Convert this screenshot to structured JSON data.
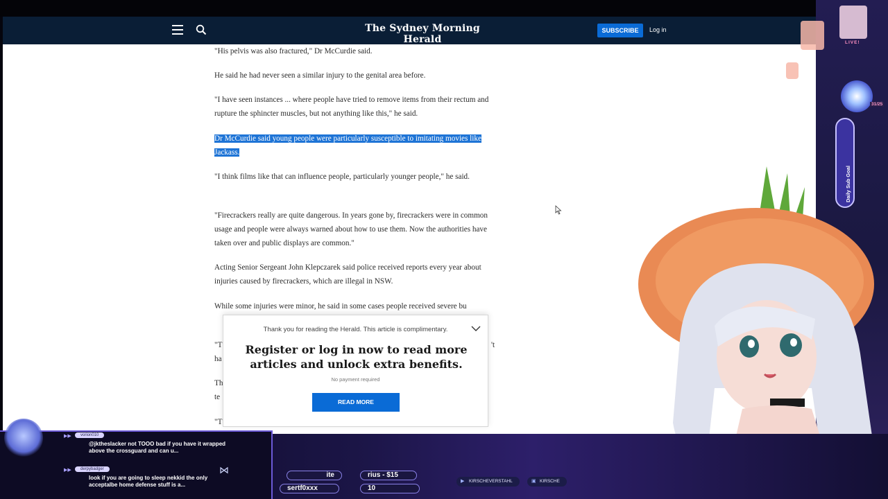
{
  "site": {
    "logo": "The Sydney Morning Herald",
    "subscribe": "SUBSCRIBE",
    "login": "Log in"
  },
  "article": {
    "paragraphs": [
      "\"His pelvis was also fractured,\" Dr McCurdie said.",
      "He said he had never seen a similar injury to the genital area before.",
      "\"I have seen instances ... where people have tried to remove items from their rectum and rupture the sphincter muscles, but not anything like this,\" he said.",
      "Dr McCurdie said young people were particularly susceptible to imitating movies like Jackass.",
      "\"I think films like that can influence people, particularly younger people,\" he said.",
      "\"Firecrackers really are quite dangerous. In years gone by, firecrackers were in common usage and people were always warned about how to use them. Now the authorities have taken over and public displays are common.\"",
      "Acting Senior Sergeant John Klepczarek said police received reports every year about injuries caused by firecrackers, which are illegal in NSW.",
      "While some injuries were minor, he said in some cases people received severe bu"
    ],
    "partials": [
      "\"T",
      "ha",
      "Th",
      "te",
      "\"T",
      "'t"
    ]
  },
  "paywall": {
    "intro": "Thank you for reading the Herald. This article is complimentary.",
    "heading": "Register or log in now to read more articles and unlock extra benefits.",
    "no_payment": "No payment required",
    "button": "READ MORE"
  },
  "stream": {
    "chat": [
      {
        "user": "vorion010",
        "message": "@jktheslacker not TOOO bad if you have it wrapped above the crossguard and can u..."
      },
      {
        "user": "derpybadger",
        "message": "look if you are going to sleep nekkid the only acceptalbe home defense stuff is a..."
      }
    ],
    "ticker": {
      "t1": "ite",
      "t2": "rius - $15",
      "t3": "sertf0xxx",
      "t4": "10"
    },
    "socials": [
      "KIRSCHEVERSTAHL",
      "KIRSCHE"
    ],
    "goal": {
      "label": "Daily Sub Goal",
      "count": "31/25",
      "live": "LIVE!",
      "progress": 1.0
    }
  },
  "colors": {
    "navbar": "#0a1e36",
    "accent": "#0a6bd6",
    "highlight": "#1e74d6",
    "overlay": "#1b1546"
  }
}
